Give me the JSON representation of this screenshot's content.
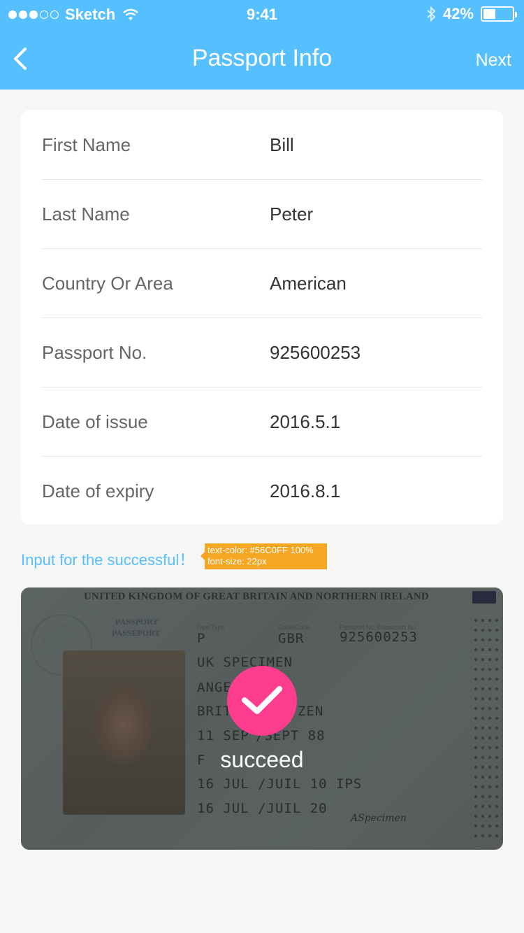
{
  "status_bar": {
    "carrier": "Sketch",
    "time": "9:41",
    "battery": "42%",
    "battery_level": 0.42
  },
  "nav": {
    "title": "Passport Info",
    "next_label": "Next"
  },
  "fields": [
    {
      "label": "First Name",
      "value": "Bill"
    },
    {
      "label": "Last Name",
      "value": "Peter"
    },
    {
      "label": "Country Or Area",
      "value": "American"
    },
    {
      "label": "Passport No.",
      "value": "925600253"
    },
    {
      "label": "Date of issue",
      "value": "2016.5.1"
    },
    {
      "label": "Date of expiry",
      "value": "2016.8.1"
    }
  ],
  "hint": {
    "text": "Input for the successful！",
    "annotation_line1": "text-color: #56C0FF 100%",
    "annotation_line2": "font-size: 22px"
  },
  "passport": {
    "header": "UNITED KINGDOM OF GREAT BRITAIN AND NORTHERN IRELAND",
    "word1": "PASSPORT",
    "word2": "PASSEPORT",
    "type": "P",
    "code": "GBR",
    "number": "925600253",
    "surname": "UK SPECIMEN",
    "given": "ANGE",
    "nationality": "BRIT",
    "nationality_end": "ZEN",
    "birth": "11 SEP",
    "birth_end": "/SEPT 88",
    "sex": "F",
    "issue_date": "16 JUL /JUIL 10 IPS",
    "expiry_date": "16 JUL /JUIL 20",
    "signature": "ASpecimen",
    "status": "succeed"
  },
  "colors": {
    "accent": "#56C0FF",
    "success": "#FF3D8F"
  }
}
